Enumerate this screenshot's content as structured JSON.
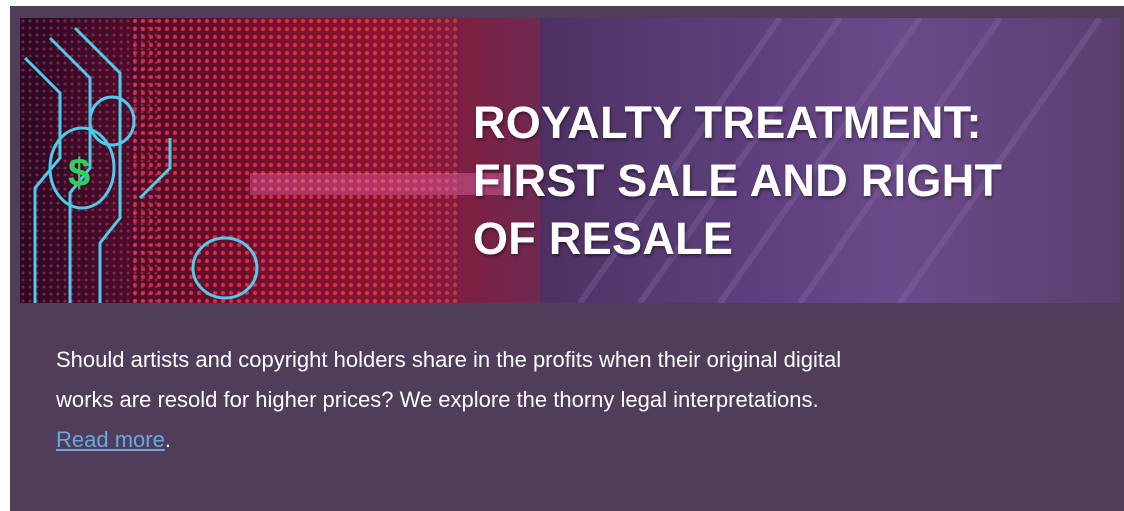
{
  "article": {
    "headline_lines": [
      "ROYALTY TREATMENT:",
      "FIRST SALE AND RIGHT",
      "OF RESALE"
    ],
    "summary_line_1": "Should artists and copyright holders share in the profits when their original digital",
    "summary_line_2": "works are resold for higher prices? We explore the thorny legal interpretations.",
    "read_more_label": "Read more",
    "read_more_suffix": "."
  },
  "colors": {
    "card_background": "#4f3d5a",
    "link": "#6aa9e0",
    "text": "#ffffff"
  }
}
